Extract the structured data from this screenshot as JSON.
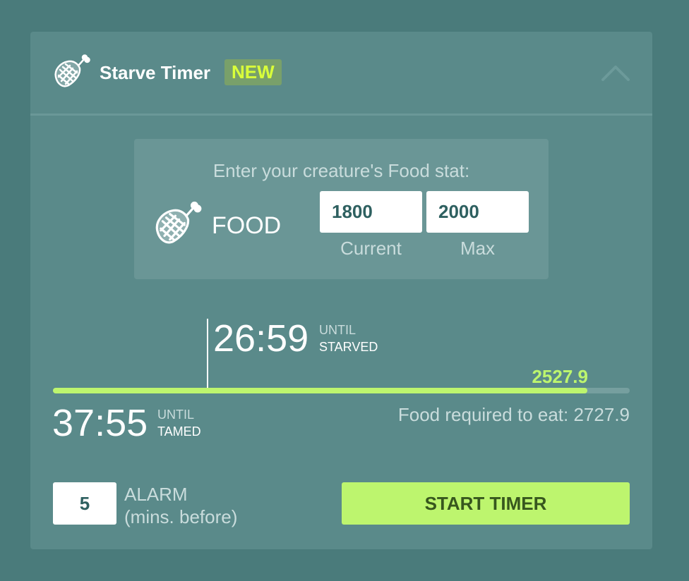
{
  "header": {
    "title": "Starve Timer",
    "badge": "NEW",
    "icon": "meat-icon",
    "collapse_icon": "chevron-up-icon"
  },
  "food_stat": {
    "prompt": "Enter your creature's Food stat:",
    "label": "FOOD",
    "icon": "meat-icon",
    "current_value": "1800",
    "current_label": "Current",
    "max_value": "2000",
    "max_label": "Max"
  },
  "starve": {
    "time": "26:59",
    "until": "UNTIL",
    "state": "STARVED"
  },
  "progress": {
    "value_text": "2527.9",
    "fill_fraction": 0.927
  },
  "tame": {
    "time": "37:55",
    "until": "UNTIL",
    "state": "TAMED"
  },
  "food_required": "Food required to eat: 2727.9",
  "alarm": {
    "value": "5",
    "label_line1": "ALARM",
    "label_line2": "(mins. before)"
  },
  "start_button": "START TIMER",
  "colors": {
    "background": "#4a7b7b",
    "panel": "#5a8a8a",
    "accent_green": "#bdf56e",
    "badge_text": "#d9ff3a"
  }
}
